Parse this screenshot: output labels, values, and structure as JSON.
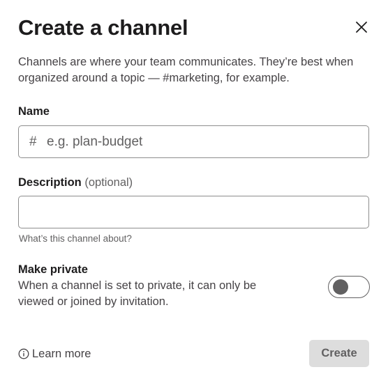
{
  "dialog": {
    "title": "Create a channel",
    "intro": "Channels are where your team communicates. They’re best when organized around a topic — #marketing, for example."
  },
  "name_field": {
    "label": "Name",
    "prefix": "#",
    "value": "",
    "placeholder": "e.g. plan-budget"
  },
  "description_field": {
    "label": "Description",
    "optional_label": "(optional)",
    "value": "",
    "placeholder": "",
    "hint": "What’s this channel about?"
  },
  "private_setting": {
    "title": "Make private",
    "description": "When a channel is set to private, it can only be viewed or joined by invitation.",
    "enabled": false
  },
  "footer": {
    "learn_more": "Learn more",
    "create_label": "Create"
  },
  "icons": {
    "close": "close-icon",
    "info": "info-icon",
    "hash": "hash-icon"
  },
  "colors": {
    "text_primary": "#1d1c1d",
    "text_secondary": "#616061",
    "border": "#8d8d8d",
    "button_disabled_bg": "#dddddd"
  }
}
